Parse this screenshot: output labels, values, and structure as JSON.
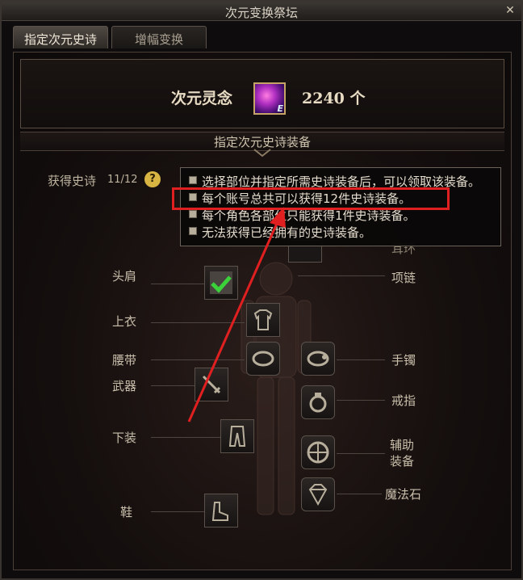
{
  "window": {
    "title": "次元变换祭坛"
  },
  "tabs": [
    {
      "label": "指定次元史诗",
      "active": true
    },
    {
      "label": "增幅变换",
      "active": false
    }
  ],
  "header": {
    "label": "次元灵念",
    "count": "2240 个",
    "icon": "dimension-essence-icon"
  },
  "section_title": "指定次元史诗装备",
  "obtained": {
    "label": "获得史诗",
    "value": "11/12"
  },
  "tooltip": {
    "lines": [
      "选择部位并指定所需史诗装备后，可以领取该装备。",
      "每个账号总共可以获得12件史诗装备。",
      "每个角色各部位只能获得1件史诗装备。",
      "无法获得已经拥有的史诗装备。"
    ],
    "highlighted_index": 1
  },
  "slots_left": [
    {
      "label": "头肩",
      "icon": "shoulder-icon",
      "checked": true
    },
    {
      "label": "上衣",
      "icon": "top-icon"
    },
    {
      "label": "腰带",
      "icon": "belt-icon"
    },
    {
      "label": "武器",
      "icon": "weapon-icon"
    },
    {
      "label": "下装",
      "icon": "pants-icon"
    },
    {
      "label": "鞋",
      "icon": "shoes-icon"
    }
  ],
  "slots_right": [
    {
      "label": "项链",
      "icon": "necklace-icon"
    },
    {
      "label": "手镯",
      "icon": "bracelet-icon"
    },
    {
      "label": "戒指",
      "icon": "ring-icon"
    },
    {
      "label": "辅助装备",
      "icon": "support-equipment-icon"
    },
    {
      "label": "魔法石",
      "icon": "magic-stone-icon"
    }
  ],
  "partial_label": "耳环",
  "colors": {
    "highlight": "#e02020",
    "accent": "#d8b443"
  }
}
